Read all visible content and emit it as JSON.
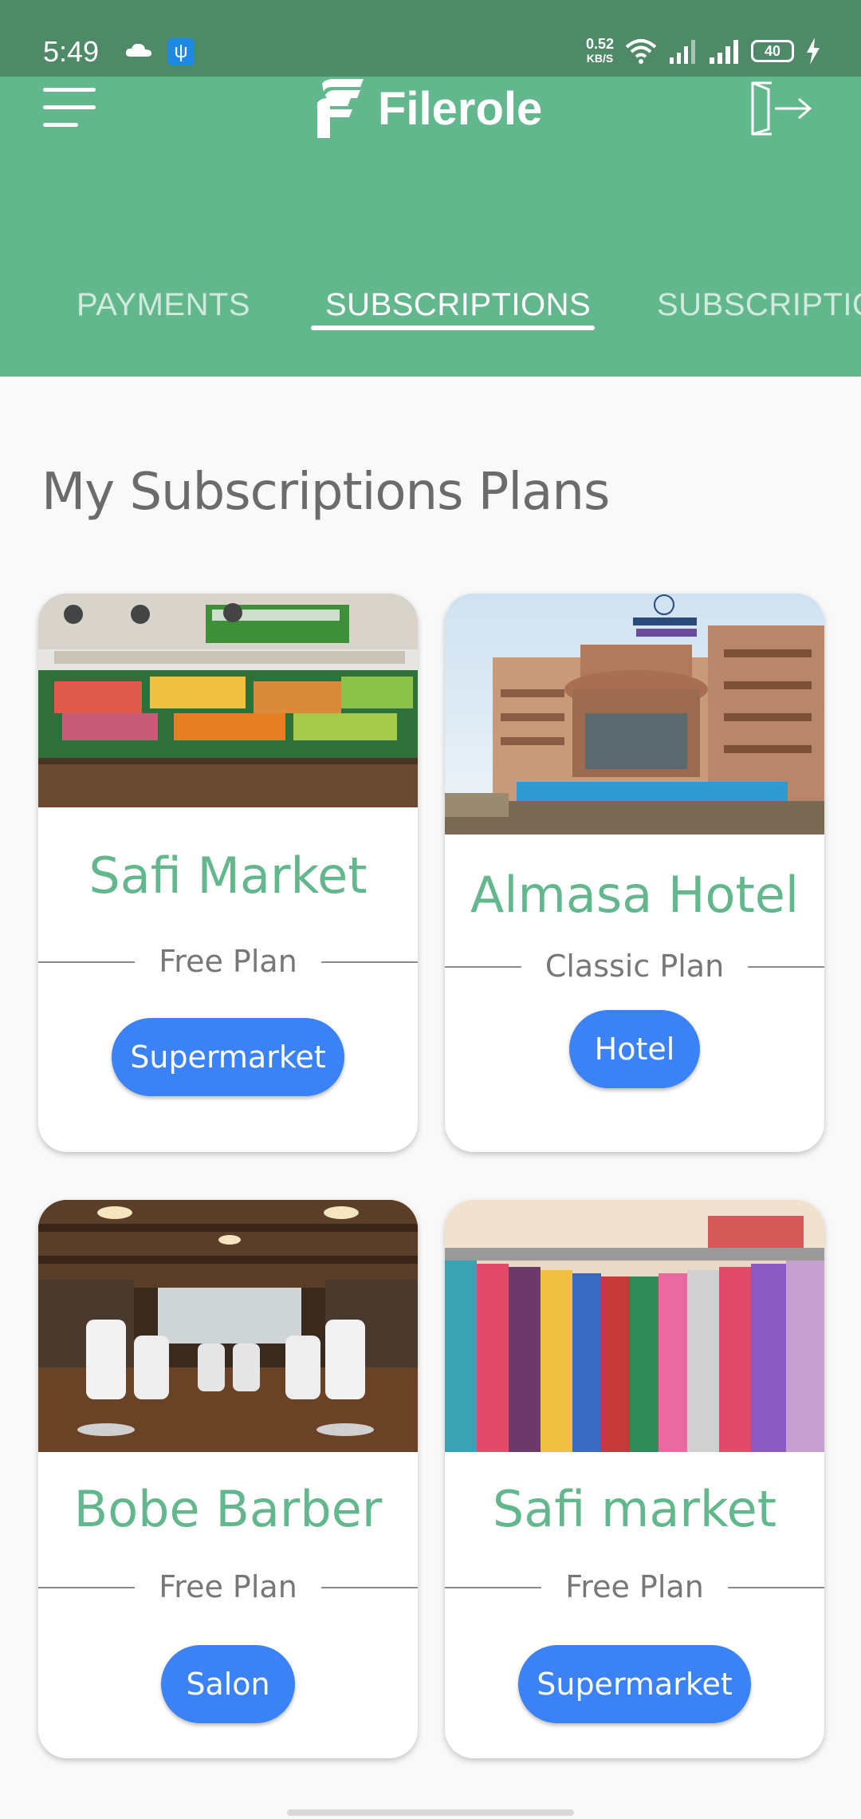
{
  "status_bar": {
    "time": "5:49",
    "net_speed_value": "0.52",
    "net_speed_unit": "KB/S",
    "battery": "40"
  },
  "header": {
    "app_name": "Filerole"
  },
  "tabs": [
    {
      "label": "PAYMENTS",
      "active": false
    },
    {
      "label": "SUBSCRIPTIONS",
      "active": true
    },
    {
      "label": "SUBSCRIPTIO",
      "active": false
    }
  ],
  "page": {
    "title": "My Subscriptions Plans"
  },
  "cards": [
    {
      "name": "Safi Market",
      "plan": "Free Plan",
      "category": "Supermarket"
    },
    {
      "name": "Almasa Hotel",
      "plan": "Classic Plan",
      "category": "Hotel"
    },
    {
      "name": "Bobe Barber",
      "plan": "Free Plan",
      "category": "Salon"
    },
    {
      "name": "Safi market",
      "plan": "Free Plan",
      "category": "Supermarket"
    }
  ],
  "colors": {
    "primary_green": "#62b88c",
    "status_green": "#4e8a68",
    "button_blue": "#3b82f6"
  }
}
